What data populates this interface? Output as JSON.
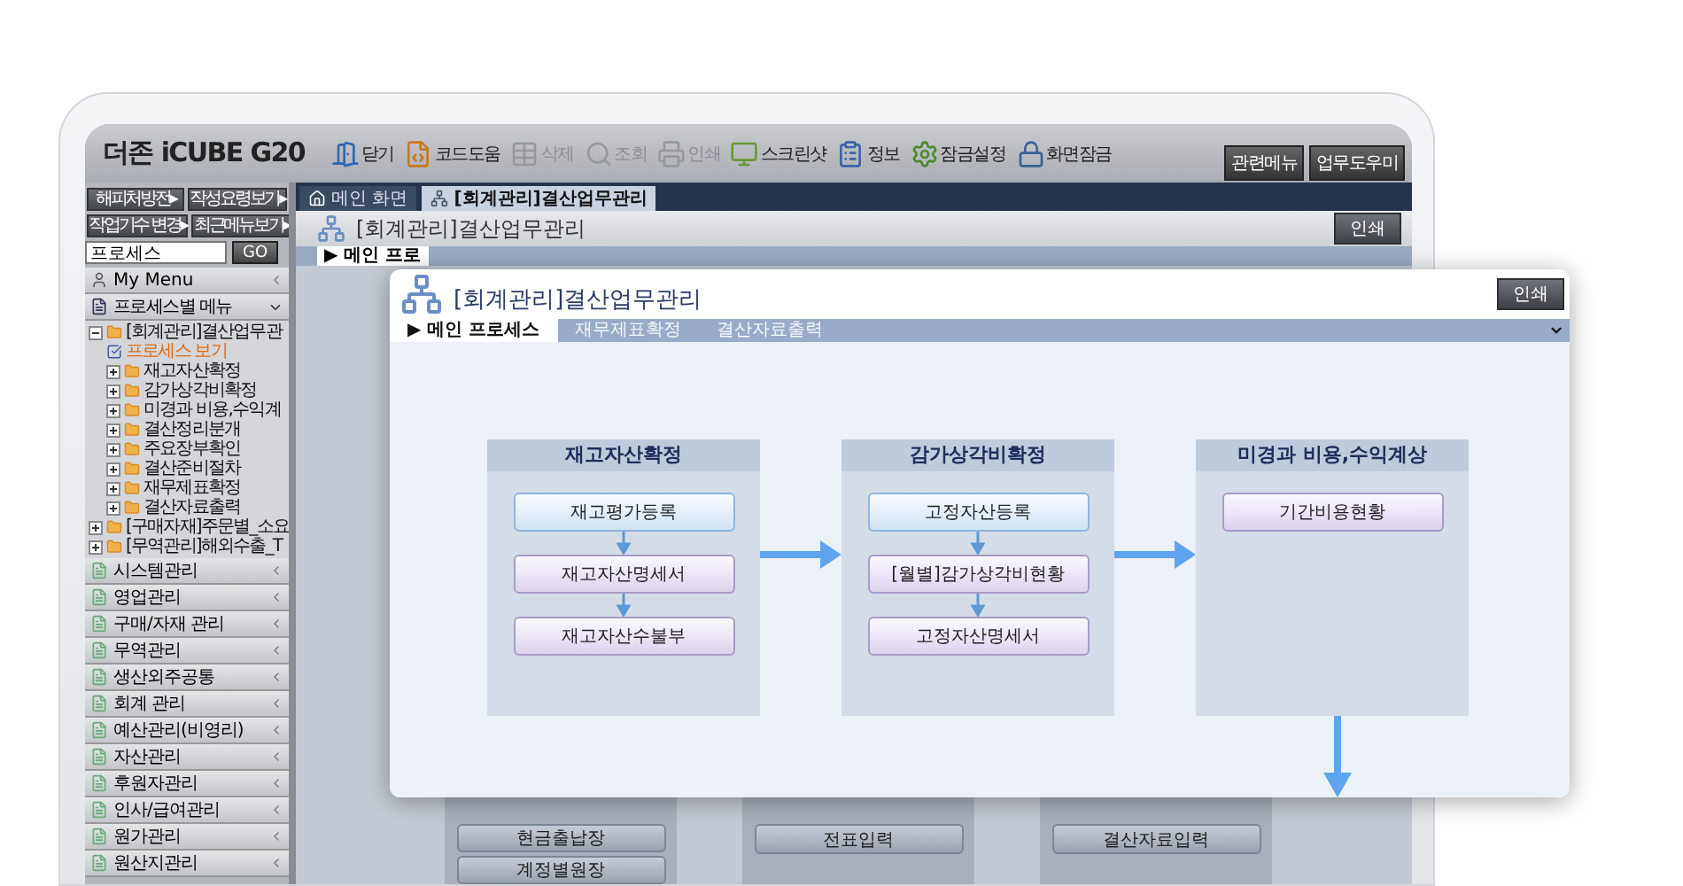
{
  "app": {
    "logo": "더존 iCUBE G20",
    "toolbar": [
      {
        "label": "닫기",
        "disabled": false
      },
      {
        "label": "코드도움",
        "disabled": false
      },
      {
        "label": "삭제",
        "disabled": true
      },
      {
        "label": "조회",
        "disabled": true
      },
      {
        "label": "인쇄",
        "disabled": true
      },
      {
        "label": "스크린샷",
        "disabled": false
      },
      {
        "label": "정보",
        "disabled": false
      },
      {
        "label": "잠금설정",
        "disabled": false
      },
      {
        "label": "화면잠금",
        "disabled": false
      }
    ],
    "header_buttons": [
      "관련메뉴",
      "업무도우미"
    ]
  },
  "sidebar": {
    "quick_buttons": [
      "해피처방전▸",
      "작성요령보기▸",
      "작업기수 변경▸",
      "최근메뉴보기▸"
    ],
    "search": {
      "value": "프로세스",
      "button": "GO"
    },
    "my_menu": "My Menu",
    "process_menu": {
      "title": "프로세스별 메뉴",
      "expanded": true,
      "tree": [
        {
          "label": "[회계관리]결산업무관",
          "kind": "folder",
          "expanded": true,
          "children": [
            {
              "label": "프로세스 보기",
              "kind": "view"
            },
            {
              "label": "재고자산확정",
              "kind": "folder",
              "expanded": false
            },
            {
              "label": "감가상각비확정",
              "kind": "folder",
              "expanded": false
            },
            {
              "label": "미경과 비용,수익계",
              "kind": "folder",
              "expanded": false
            },
            {
              "label": "결산정리분개",
              "kind": "folder",
              "expanded": false
            },
            {
              "label": "주요장부확인",
              "kind": "folder",
              "expanded": false
            },
            {
              "label": "결산준비절차",
              "kind": "folder",
              "expanded": false
            },
            {
              "label": "재무제표확정",
              "kind": "folder",
              "expanded": false
            },
            {
              "label": "결산자료출력",
              "kind": "folder",
              "expanded": false
            }
          ]
        },
        {
          "label": "[구매자재]주문별_소요",
          "kind": "folder",
          "expanded": false
        },
        {
          "label": "[무역관리]해외수출_T",
          "kind": "folder",
          "expanded": false
        }
      ]
    },
    "menus": [
      "시스템관리",
      "영업관리",
      "구매/자재 관리",
      "무역관리",
      "생산외주공통",
      "회계 관리",
      "예산관리(비영리)",
      "자산관리",
      "후원자관리",
      "인사/급여관리",
      "원가관리",
      "원산지관리"
    ]
  },
  "main": {
    "tabs": [
      {
        "label": "메인 화면",
        "kind": "home",
        "selected": false
      },
      {
        "label": "[회계관리]결산업무관리",
        "kind": "process",
        "selected": true
      }
    ],
    "title": "[회계관리]결산업무관리",
    "print_button": "인쇄",
    "process_tab": "▶ 메인 프로",
    "lower_columns": [
      {
        "steps": [
          "현금출납장",
          "계정별원장"
        ]
      },
      {
        "steps": [
          "전표입력"
        ]
      },
      {
        "steps": [
          "결산자료입력"
        ]
      }
    ]
  },
  "overlay": {
    "title": "[회계관리]결산업무관리",
    "print_button": "인쇄",
    "tabs": [
      {
        "label": "▶ 메인 프로세스",
        "selected": true
      },
      {
        "label": "재무제표확정",
        "selected": false
      },
      {
        "label": "결산자료출력",
        "selected": false
      }
    ],
    "columns": [
      {
        "title": "재고자산확정",
        "steps": [
          {
            "label": "재고평가등록",
            "kind": "start"
          },
          {
            "label": "재고자산명세서",
            "kind": "step"
          },
          {
            "label": "재고자산수불부",
            "kind": "step"
          }
        ]
      },
      {
        "title": "감가상각비확정",
        "steps": [
          {
            "label": "고정자산등록",
            "kind": "start"
          },
          {
            "label": "[월별]감가상각비현황",
            "kind": "step"
          },
          {
            "label": "고정자산명세서",
            "kind": "step"
          }
        ]
      },
      {
        "title": "미경과 비용,수익계상",
        "steps": [
          {
            "label": "기간비용현황",
            "kind": "step"
          }
        ]
      }
    ]
  }
}
